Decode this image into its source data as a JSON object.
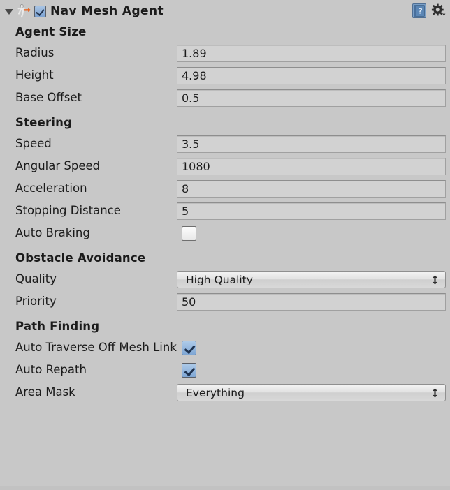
{
  "header": {
    "title": "Nav Mesh Agent",
    "enabled_checkbox": "checked",
    "foldout_state": "expanded",
    "component_icon": "navmesh-agent-icon",
    "help_icon": "help-book-icon",
    "settings_icon": "gear-icon"
  },
  "sections": [
    {
      "title": "Agent Size",
      "rows": [
        {
          "label": "Radius",
          "type": "number",
          "value": "1.89"
        },
        {
          "label": "Height",
          "type": "number",
          "value": "4.98"
        },
        {
          "label": "Base Offset",
          "type": "number",
          "value": "0.5"
        }
      ]
    },
    {
      "title": "Steering",
      "rows": [
        {
          "label": "Speed",
          "type": "number",
          "value": "3.5"
        },
        {
          "label": "Angular Speed",
          "type": "number",
          "value": "1080"
        },
        {
          "label": "Acceleration",
          "type": "number",
          "value": "8"
        },
        {
          "label": "Stopping Distance",
          "type": "number",
          "value": "5"
        },
        {
          "label": "Auto Braking",
          "type": "checkbox",
          "value": "unchecked"
        }
      ]
    },
    {
      "title": "Obstacle Avoidance",
      "rows": [
        {
          "label": "Quality",
          "type": "dropdown",
          "value": "High Quality"
        },
        {
          "label": "Priority",
          "type": "number",
          "value": "50"
        }
      ]
    },
    {
      "title": "Path Finding",
      "rows": [
        {
          "label": "Auto Traverse Off Mesh Link",
          "type": "checkbox",
          "value": "checked"
        },
        {
          "label": "Auto Repath",
          "type": "checkbox",
          "value": "checked"
        },
        {
          "label": "Area Mask",
          "type": "dropdown",
          "value": "Everything"
        }
      ]
    }
  ],
  "colors": {
    "panel_background": "#c8c8c8",
    "field_background": "#d2d2d2",
    "checkbox_checked": "#7ea6d4",
    "text": "#1b1b1b",
    "icon_accent": "#e8601c"
  }
}
